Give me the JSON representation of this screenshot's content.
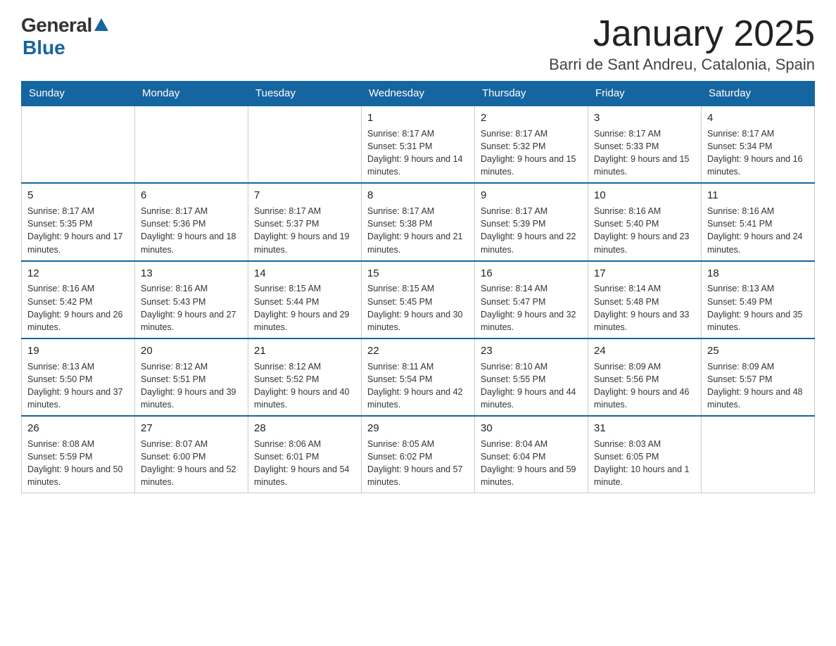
{
  "logo": {
    "general": "General",
    "blue": "Blue"
  },
  "title": "January 2025",
  "subtitle": "Barri de Sant Andreu, Catalonia, Spain",
  "days_of_week": [
    "Sunday",
    "Monday",
    "Tuesday",
    "Wednesday",
    "Thursday",
    "Friday",
    "Saturday"
  ],
  "weeks": [
    [
      {
        "day": "",
        "sunrise": "",
        "sunset": "",
        "daylight": ""
      },
      {
        "day": "",
        "sunrise": "",
        "sunset": "",
        "daylight": ""
      },
      {
        "day": "",
        "sunrise": "",
        "sunset": "",
        "daylight": ""
      },
      {
        "day": "1",
        "sunrise": "Sunrise: 8:17 AM",
        "sunset": "Sunset: 5:31 PM",
        "daylight": "Daylight: 9 hours and 14 minutes."
      },
      {
        "day": "2",
        "sunrise": "Sunrise: 8:17 AM",
        "sunset": "Sunset: 5:32 PM",
        "daylight": "Daylight: 9 hours and 15 minutes."
      },
      {
        "day": "3",
        "sunrise": "Sunrise: 8:17 AM",
        "sunset": "Sunset: 5:33 PM",
        "daylight": "Daylight: 9 hours and 15 minutes."
      },
      {
        "day": "4",
        "sunrise": "Sunrise: 8:17 AM",
        "sunset": "Sunset: 5:34 PM",
        "daylight": "Daylight: 9 hours and 16 minutes."
      }
    ],
    [
      {
        "day": "5",
        "sunrise": "Sunrise: 8:17 AM",
        "sunset": "Sunset: 5:35 PM",
        "daylight": "Daylight: 9 hours and 17 minutes."
      },
      {
        "day": "6",
        "sunrise": "Sunrise: 8:17 AM",
        "sunset": "Sunset: 5:36 PM",
        "daylight": "Daylight: 9 hours and 18 minutes."
      },
      {
        "day": "7",
        "sunrise": "Sunrise: 8:17 AM",
        "sunset": "Sunset: 5:37 PM",
        "daylight": "Daylight: 9 hours and 19 minutes."
      },
      {
        "day": "8",
        "sunrise": "Sunrise: 8:17 AM",
        "sunset": "Sunset: 5:38 PM",
        "daylight": "Daylight: 9 hours and 21 minutes."
      },
      {
        "day": "9",
        "sunrise": "Sunrise: 8:17 AM",
        "sunset": "Sunset: 5:39 PM",
        "daylight": "Daylight: 9 hours and 22 minutes."
      },
      {
        "day": "10",
        "sunrise": "Sunrise: 8:16 AM",
        "sunset": "Sunset: 5:40 PM",
        "daylight": "Daylight: 9 hours and 23 minutes."
      },
      {
        "day": "11",
        "sunrise": "Sunrise: 8:16 AM",
        "sunset": "Sunset: 5:41 PM",
        "daylight": "Daylight: 9 hours and 24 minutes."
      }
    ],
    [
      {
        "day": "12",
        "sunrise": "Sunrise: 8:16 AM",
        "sunset": "Sunset: 5:42 PM",
        "daylight": "Daylight: 9 hours and 26 minutes."
      },
      {
        "day": "13",
        "sunrise": "Sunrise: 8:16 AM",
        "sunset": "Sunset: 5:43 PM",
        "daylight": "Daylight: 9 hours and 27 minutes."
      },
      {
        "day": "14",
        "sunrise": "Sunrise: 8:15 AM",
        "sunset": "Sunset: 5:44 PM",
        "daylight": "Daylight: 9 hours and 29 minutes."
      },
      {
        "day": "15",
        "sunrise": "Sunrise: 8:15 AM",
        "sunset": "Sunset: 5:45 PM",
        "daylight": "Daylight: 9 hours and 30 minutes."
      },
      {
        "day": "16",
        "sunrise": "Sunrise: 8:14 AM",
        "sunset": "Sunset: 5:47 PM",
        "daylight": "Daylight: 9 hours and 32 minutes."
      },
      {
        "day": "17",
        "sunrise": "Sunrise: 8:14 AM",
        "sunset": "Sunset: 5:48 PM",
        "daylight": "Daylight: 9 hours and 33 minutes."
      },
      {
        "day": "18",
        "sunrise": "Sunrise: 8:13 AM",
        "sunset": "Sunset: 5:49 PM",
        "daylight": "Daylight: 9 hours and 35 minutes."
      }
    ],
    [
      {
        "day": "19",
        "sunrise": "Sunrise: 8:13 AM",
        "sunset": "Sunset: 5:50 PM",
        "daylight": "Daylight: 9 hours and 37 minutes."
      },
      {
        "day": "20",
        "sunrise": "Sunrise: 8:12 AM",
        "sunset": "Sunset: 5:51 PM",
        "daylight": "Daylight: 9 hours and 39 minutes."
      },
      {
        "day": "21",
        "sunrise": "Sunrise: 8:12 AM",
        "sunset": "Sunset: 5:52 PM",
        "daylight": "Daylight: 9 hours and 40 minutes."
      },
      {
        "day": "22",
        "sunrise": "Sunrise: 8:11 AM",
        "sunset": "Sunset: 5:54 PM",
        "daylight": "Daylight: 9 hours and 42 minutes."
      },
      {
        "day": "23",
        "sunrise": "Sunrise: 8:10 AM",
        "sunset": "Sunset: 5:55 PM",
        "daylight": "Daylight: 9 hours and 44 minutes."
      },
      {
        "day": "24",
        "sunrise": "Sunrise: 8:09 AM",
        "sunset": "Sunset: 5:56 PM",
        "daylight": "Daylight: 9 hours and 46 minutes."
      },
      {
        "day": "25",
        "sunrise": "Sunrise: 8:09 AM",
        "sunset": "Sunset: 5:57 PM",
        "daylight": "Daylight: 9 hours and 48 minutes."
      }
    ],
    [
      {
        "day": "26",
        "sunrise": "Sunrise: 8:08 AM",
        "sunset": "Sunset: 5:59 PM",
        "daylight": "Daylight: 9 hours and 50 minutes."
      },
      {
        "day": "27",
        "sunrise": "Sunrise: 8:07 AM",
        "sunset": "Sunset: 6:00 PM",
        "daylight": "Daylight: 9 hours and 52 minutes."
      },
      {
        "day": "28",
        "sunrise": "Sunrise: 8:06 AM",
        "sunset": "Sunset: 6:01 PM",
        "daylight": "Daylight: 9 hours and 54 minutes."
      },
      {
        "day": "29",
        "sunrise": "Sunrise: 8:05 AM",
        "sunset": "Sunset: 6:02 PM",
        "daylight": "Daylight: 9 hours and 57 minutes."
      },
      {
        "day": "30",
        "sunrise": "Sunrise: 8:04 AM",
        "sunset": "Sunset: 6:04 PM",
        "daylight": "Daylight: 9 hours and 59 minutes."
      },
      {
        "day": "31",
        "sunrise": "Sunrise: 8:03 AM",
        "sunset": "Sunset: 6:05 PM",
        "daylight": "Daylight: 10 hours and 1 minute."
      },
      {
        "day": "",
        "sunrise": "",
        "sunset": "",
        "daylight": ""
      }
    ]
  ]
}
